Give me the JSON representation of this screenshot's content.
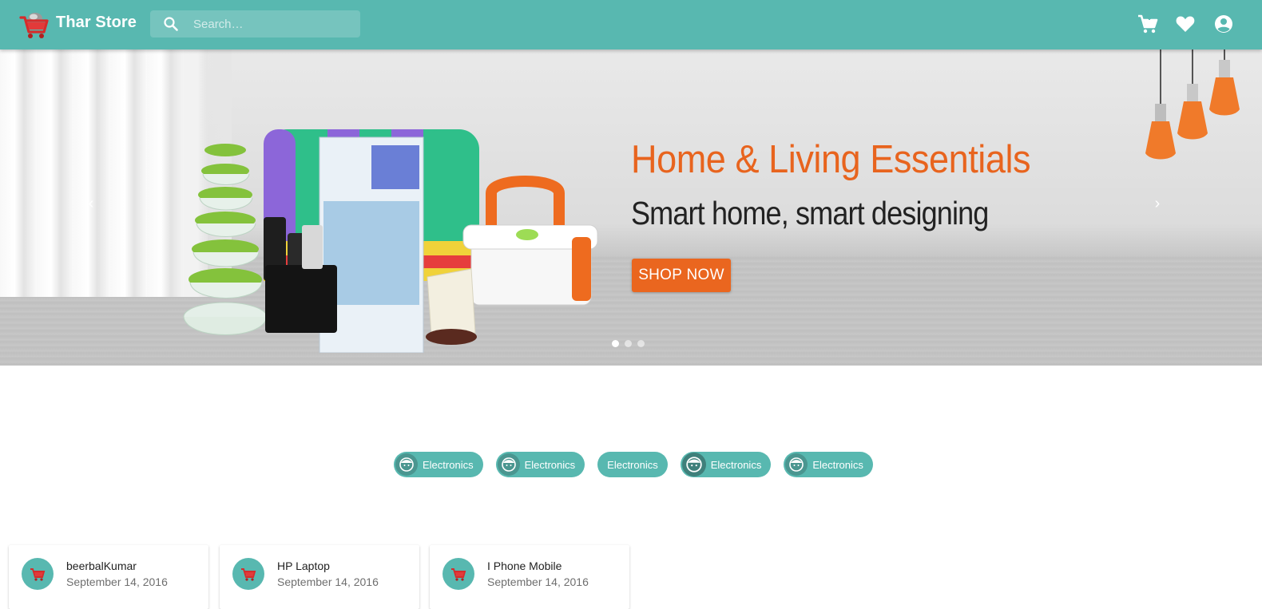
{
  "header": {
    "brand": "Thar Store",
    "search_placeholder": "Search…",
    "icons": [
      "cart-icon",
      "heart-icon",
      "account-icon"
    ]
  },
  "hero": {
    "title": "Home & Living Essentials",
    "subtitle": "Smart home, smart designing",
    "cta_label": "SHOP NOW",
    "prev_glyph": "‹",
    "next_glyph": "›",
    "slide_count": 3,
    "active_slide": 1
  },
  "chips": [
    {
      "label": "Electronics",
      "avatar": true
    },
    {
      "label": "Electronics",
      "avatar": true
    },
    {
      "label": "Electronics",
      "avatar": false
    },
    {
      "label": "Electronics",
      "avatar": true
    },
    {
      "label": "Electronics",
      "avatar": true
    }
  ],
  "cards": [
    {
      "title": "beerbalKumar",
      "date": "September 14, 2016"
    },
    {
      "title": "HP Laptop",
      "date": "September 14, 2016"
    },
    {
      "title": "I Phone Mobile",
      "date": "September 14, 2016"
    }
  ],
  "colors": {
    "primary": "#58b8b0",
    "accent": "#ea661f",
    "hero_title": "#e8641e"
  }
}
